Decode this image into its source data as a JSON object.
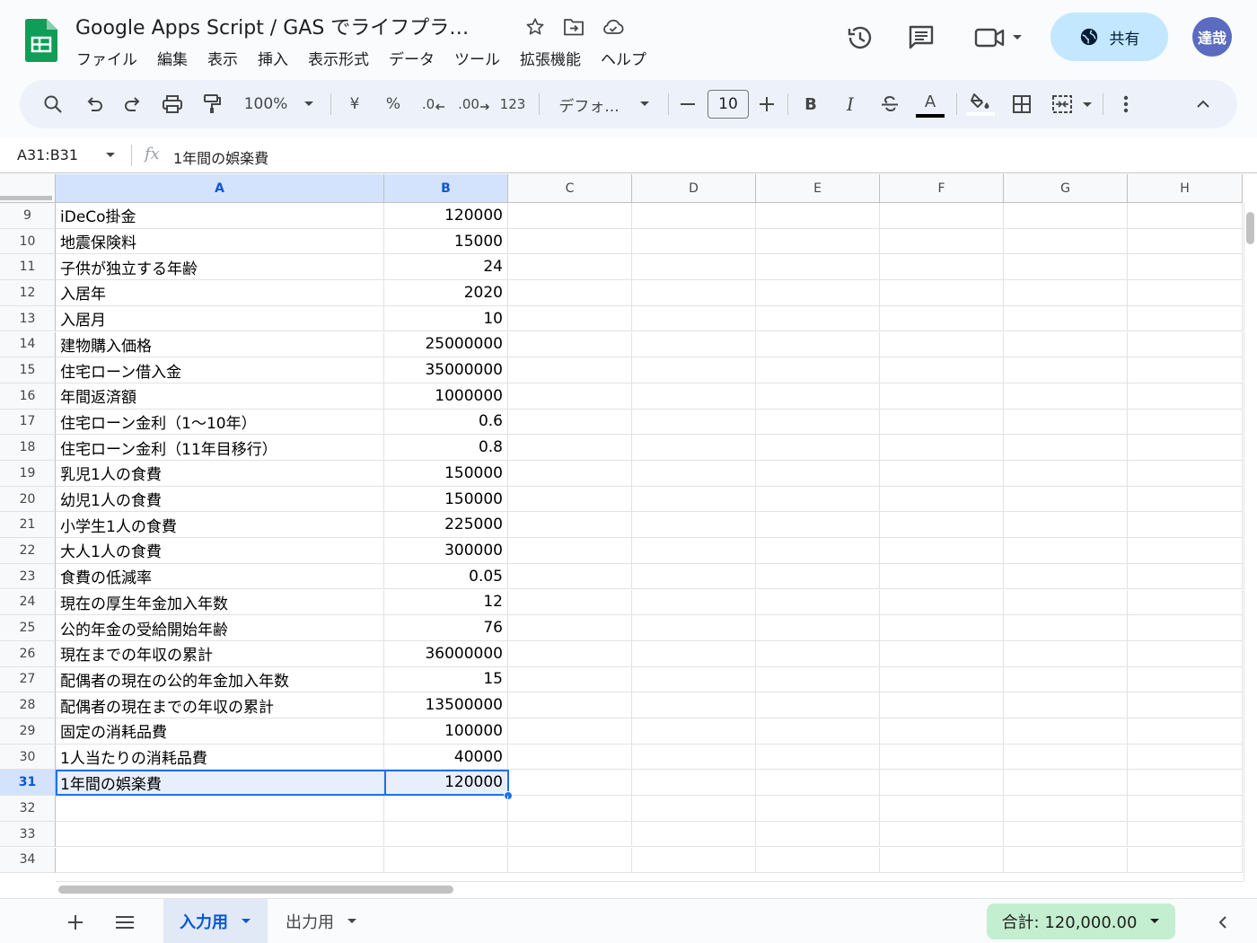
{
  "app": {
    "doc_title": "Google Apps Script / GAS でライフプラ…",
    "menus": [
      "ファイル",
      "編集",
      "表示",
      "挿入",
      "表示形式",
      "データ",
      "ツール",
      "拡張機能",
      "ヘルプ"
    ],
    "share_label": "共有",
    "avatar_text": "達哉"
  },
  "toolbar": {
    "zoom": "100%",
    "currency": "¥",
    "percent": "%",
    "dec_decrease": ".0",
    "dec_increase": ".00",
    "number_format": "123",
    "font": "デフォ...",
    "font_size": "10",
    "bold": "B",
    "italic": "I",
    "text_color_glyph": "A"
  },
  "formula_bar": {
    "name_box": "A31:B31",
    "fx": "fx",
    "content": "1年間の娯楽費"
  },
  "columns": [
    "A",
    "B",
    "C",
    "D",
    "E",
    "F",
    "G",
    "H"
  ],
  "selected_columns": [
    "A",
    "B"
  ],
  "rows": [
    {
      "num": "9",
      "a": "iDeCo掛金",
      "b": "120000"
    },
    {
      "num": "10",
      "a": "地震保険料",
      "b": "15000"
    },
    {
      "num": "11",
      "a": "子供が独立する年齢",
      "b": "24"
    },
    {
      "num": "12",
      "a": "入居年",
      "b": "2020"
    },
    {
      "num": "13",
      "a": "入居月",
      "b": "10"
    },
    {
      "num": "14",
      "a": "建物購入価格",
      "b": "25000000"
    },
    {
      "num": "15",
      "a": "住宅ローン借入金",
      "b": "35000000"
    },
    {
      "num": "16",
      "a": "年間返済額",
      "b": "1000000"
    },
    {
      "num": "17",
      "a": "住宅ローン金利（1〜10年）",
      "b": "0.6"
    },
    {
      "num": "18",
      "a": "住宅ローン金利（11年目移行）",
      "b": "0.8"
    },
    {
      "num": "19",
      "a": "乳児1人の食費",
      "b": "150000"
    },
    {
      "num": "20",
      "a": "幼児1人の食費",
      "b": "150000"
    },
    {
      "num": "21",
      "a": "小学生1人の食費",
      "b": "225000"
    },
    {
      "num": "22",
      "a": "大人1人の食費",
      "b": "300000"
    },
    {
      "num": "23",
      "a": "食費の低減率",
      "b": "0.05"
    },
    {
      "num": "24",
      "a": "現在の厚生年金加入年数",
      "b": "12"
    },
    {
      "num": "25",
      "a": "公的年金の受給開始年齢",
      "b": "76"
    },
    {
      "num": "26",
      "a": "現在までの年収の累計",
      "b": "36000000"
    },
    {
      "num": "27",
      "a": "配偶者の現在の公的年金加入年数",
      "b": "15"
    },
    {
      "num": "28",
      "a": "配偶者の現在までの年収の累計",
      "b": "13500000"
    },
    {
      "num": "29",
      "a": "固定の消耗品費",
      "b": "100000"
    },
    {
      "num": "30",
      "a": "1人当たりの消耗品費",
      "b": "40000"
    },
    {
      "num": "31",
      "a": "1年間の娯楽費",
      "b": "120000",
      "selected": true
    },
    {
      "num": "32",
      "a": "",
      "b": ""
    },
    {
      "num": "33",
      "a": "",
      "b": ""
    },
    {
      "num": "34",
      "a": "",
      "b": ""
    }
  ],
  "sheets": {
    "active": "入力用",
    "other": "出力用"
  },
  "status": {
    "sum": "合計: 120,000.00"
  },
  "colors": {
    "accent": "#1a73e8",
    "share_bg": "#c2e7ff",
    "sum_bg": "#c4eed0",
    "selection_bg": "#e8effc"
  }
}
